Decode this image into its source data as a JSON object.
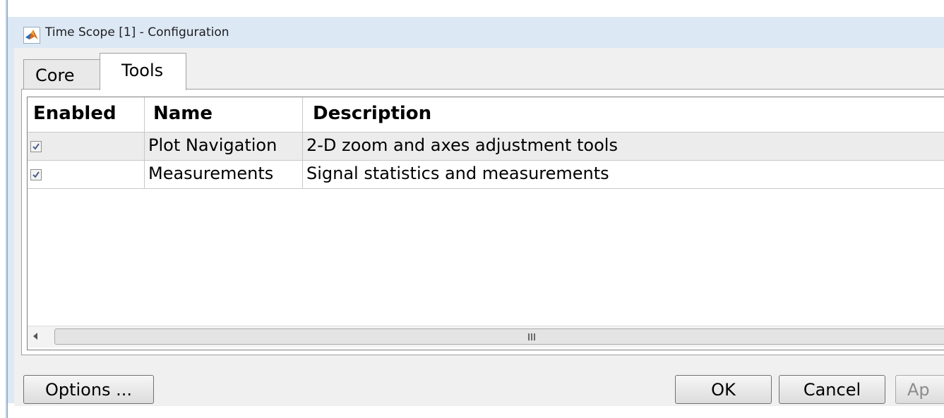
{
  "window": {
    "title": "Time Scope [1] - Configuration",
    "icon": "matlab-icon"
  },
  "tabs": [
    {
      "label": "Core",
      "selected": false
    },
    {
      "label": "Tools",
      "selected": true
    }
  ],
  "table": {
    "columns": [
      "Enabled",
      "Name",
      "Description"
    ],
    "rows": [
      {
        "enabled": true,
        "name": "Plot Navigation",
        "description": "2-D zoom and axes adjustment tools"
      },
      {
        "enabled": true,
        "name": "Measurements",
        "description": "Signal statistics and measurements"
      }
    ]
  },
  "buttons": {
    "options": "Options ...",
    "ok": "OK",
    "cancel": "Cancel",
    "apply": "Ap"
  }
}
